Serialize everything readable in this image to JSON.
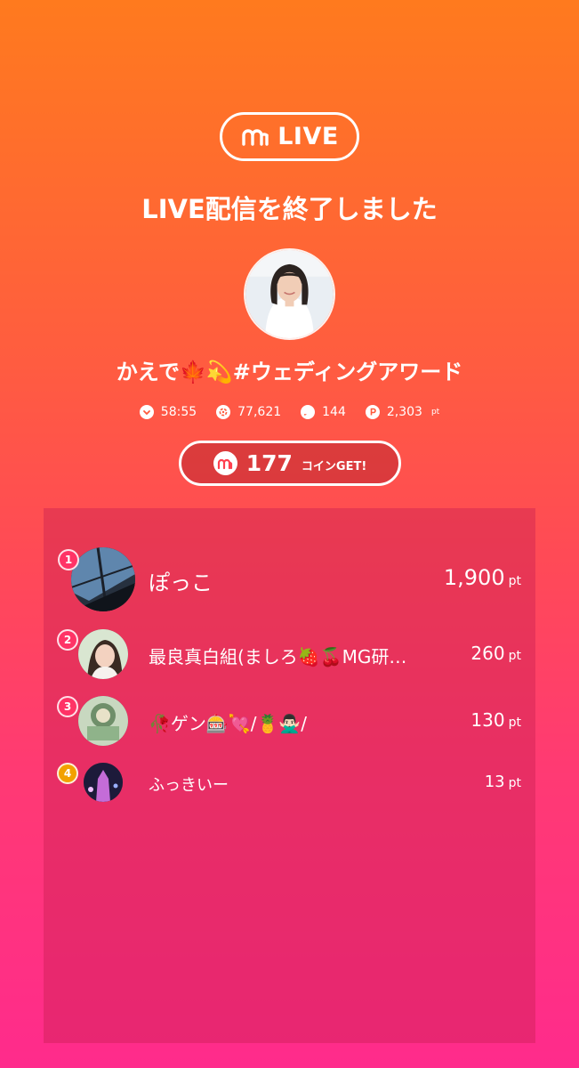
{
  "brand": {
    "label": "LIVE",
    "icon": "m-logo-icon"
  },
  "title": "LIVE配信を終了しました",
  "host": {
    "name": "かえで🍁💫#ウェディングアワード",
    "avatar": "host-avatar-photo"
  },
  "stats": {
    "duration": "58:55",
    "viewers": "77,621",
    "comments": "144",
    "points": "2,303",
    "points_unit": "pt"
  },
  "coins": {
    "amount": "177",
    "label": "コインGET!"
  },
  "ranking": [
    {
      "rank": "1",
      "name": "ぽっこ",
      "points": "1,900",
      "unit": "pt"
    },
    {
      "rank": "2",
      "name": "最良真白組(ましろ🍓🍒MG研…",
      "points": "260",
      "unit": "pt"
    },
    {
      "rank": "3",
      "name": "🥀ゲン🎰💘/🍍🙅🏻‍♂️/",
      "points": "130",
      "unit": "pt"
    },
    {
      "rank": "4",
      "name": "ふっきいー",
      "points": "13",
      "unit": "pt"
    }
  ],
  "colors": {
    "gradient_top": "#ff7a1e",
    "gradient_bottom": "#ff2b8c",
    "rank_badge": "#ff3366",
    "rank_badge_4": "#f2a100"
  }
}
